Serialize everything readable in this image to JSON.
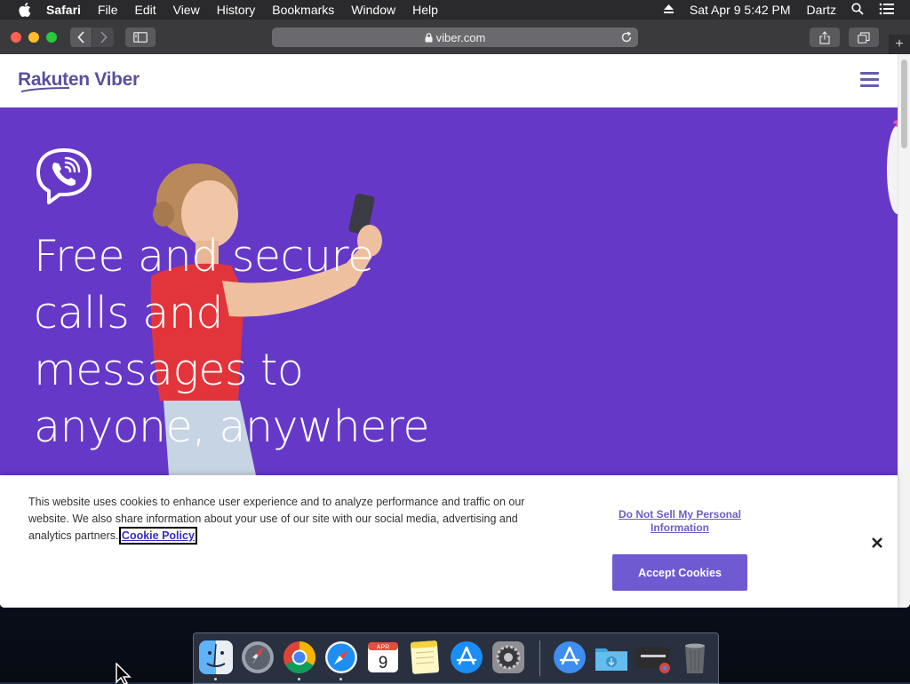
{
  "menubar": {
    "apple_icon": "apple-logo-icon",
    "app_name": "Safari",
    "items": [
      "File",
      "Edit",
      "View",
      "History",
      "Bookmarks",
      "Window",
      "Help"
    ],
    "clock": "Sat Apr 9  5:42 PM",
    "user": "Dartz",
    "status_icons": [
      "eject-icon",
      "spotlight-search-icon",
      "control-center-icon"
    ]
  },
  "browser": {
    "url": "viber.com",
    "buttons": [
      "back-icon",
      "forward-icon",
      "sidebar-icon",
      "share-icon",
      "tabs-overview-icon",
      "new-tab-icon",
      "reload-icon",
      "lock-icon"
    ],
    "new_tab_symbol": "+"
  },
  "site": {
    "logo_text": "Rakuten Viber",
    "menu_icon": "hamburger-menu-icon",
    "hero": {
      "background_color": "#6638c8",
      "headline_lines": [
        "Free and secure",
        "calls and",
        "messages to",
        "anyone, anywhere"
      ]
    }
  },
  "cookie_banner": {
    "text": "This website uses cookies to enhance user experience and to analyze performance and traffic on our website. We also share information about your use of our site with our social media, advertising and analytics partners.",
    "policy_link": "Cookie Policy",
    "do_not_sell_link": "Do Not Sell My Personal Information",
    "accept_button": "Accept Cookies",
    "accent_color": "#6f5ad1"
  },
  "dock": {
    "apps": [
      "Finder",
      "Launchpad",
      "Google Chrome",
      "Safari",
      "Calendar",
      "Notes",
      "App Store",
      "System Preferences",
      "Applications",
      "Downloads",
      "Google Chrome Window",
      "Trash"
    ],
    "calendar": {
      "month": "APR",
      "day": "9"
    }
  }
}
